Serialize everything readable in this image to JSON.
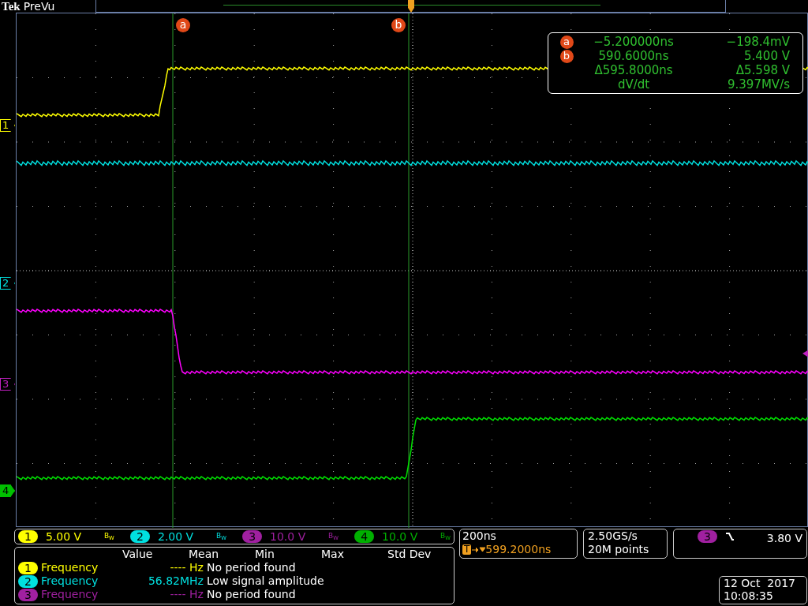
{
  "header": {
    "brand": "Tek",
    "mode": "PreVu"
  },
  "cursors": [
    {
      "label": "a"
    },
    {
      "label": "b"
    }
  ],
  "channel_markers": [
    {
      "label": "1",
      "color": "#ffff00"
    },
    {
      "label": "2",
      "color": "#00e0e0"
    },
    {
      "label": "3",
      "color": "#c020c0"
    },
    {
      "label": "4",
      "color": "#00c000"
    }
  ],
  "cursor_readout": [
    {
      "badge": "a",
      "time": "−5.200000ns",
      "value": "−198.4mV"
    },
    {
      "badge": "b",
      "time": "590.6000ns",
      "value": "5.400 V"
    },
    {
      "time": "Δ595.8000ns",
      "value": "Δ5.598 V"
    },
    {
      "time": "dV/dt",
      "value": "9.397MV/s"
    }
  ],
  "channels": [
    {
      "number": "1",
      "scale": "5.00 V",
      "bw": "B$_{W}$",
      "color": "#ffff00"
    },
    {
      "number": "2",
      "scale": "2.00 V",
      "bw": "B$_{W}$",
      "color": "#00e0e0"
    },
    {
      "number": "3",
      "scale": "10.0 V",
      "bw": "B$_{W}$",
      "color": "#a020a0"
    },
    {
      "number": "4",
      "scale": "10.0 V",
      "bw": "B$_{W}$",
      "color": "#00b000"
    }
  ],
  "measurements": {
    "columns": [
      "Value",
      "Mean",
      "Min",
      "Max",
      "Std Dev"
    ],
    "rows": [
      {
        "channel": "1",
        "color": "#ffff00",
        "name": "Frequency",
        "value": "---- Hz",
        "status": "No period found"
      },
      {
        "channel": "2",
        "color": "#00e0e0",
        "name": "Frequency",
        "value": "56.82MHz",
        "status": "Low signal amplitude"
      },
      {
        "channel": "3",
        "color": "#a020a0",
        "name": "Frequency",
        "value": "---- Hz",
        "status": "No period found"
      }
    ]
  },
  "timebase": {
    "scale": "200ns",
    "trigger_marker": "T",
    "trigger_position": "599.2000ns"
  },
  "acquisition": {
    "rate": "2.50GS/s",
    "record": "20M points"
  },
  "trigger": {
    "channel": "3",
    "color": "#a020a0",
    "level": "3.80 V"
  },
  "datetime": {
    "date": "12 Oct  2017",
    "time": "10:08:35"
  }
}
